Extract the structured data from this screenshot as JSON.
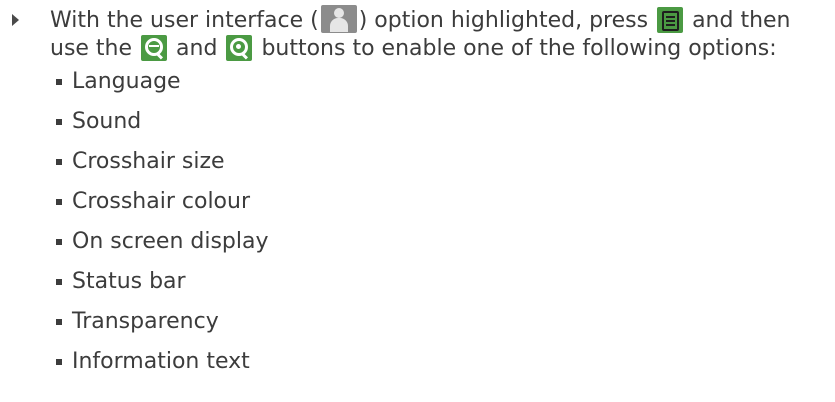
{
  "instruction": {
    "line1_part1": "With the user interface (",
    "line1_part2": ") option highlighted, press",
    "line1_part3": "and then",
    "line2_part1": "use the",
    "line2_part2": "and",
    "line2_part3": "buttons to enable one of the following options:",
    "icons": {
      "user_interface": "user-interface-icon",
      "menu": "menu-button-icon",
      "zoom_out": "zoom-out-button-icon",
      "zoom_in": "zoom-in-button-icon"
    },
    "colors": {
      "button_green": "#4b9a43",
      "user_icon_grey": "#8c8c8c",
      "text": "#3c3c3c"
    }
  },
  "options": [
    "Language",
    "Sound",
    "Crosshair size",
    "Crosshair colour",
    "On screen display",
    "Status bar",
    "Transparency",
    "Information text"
  ]
}
